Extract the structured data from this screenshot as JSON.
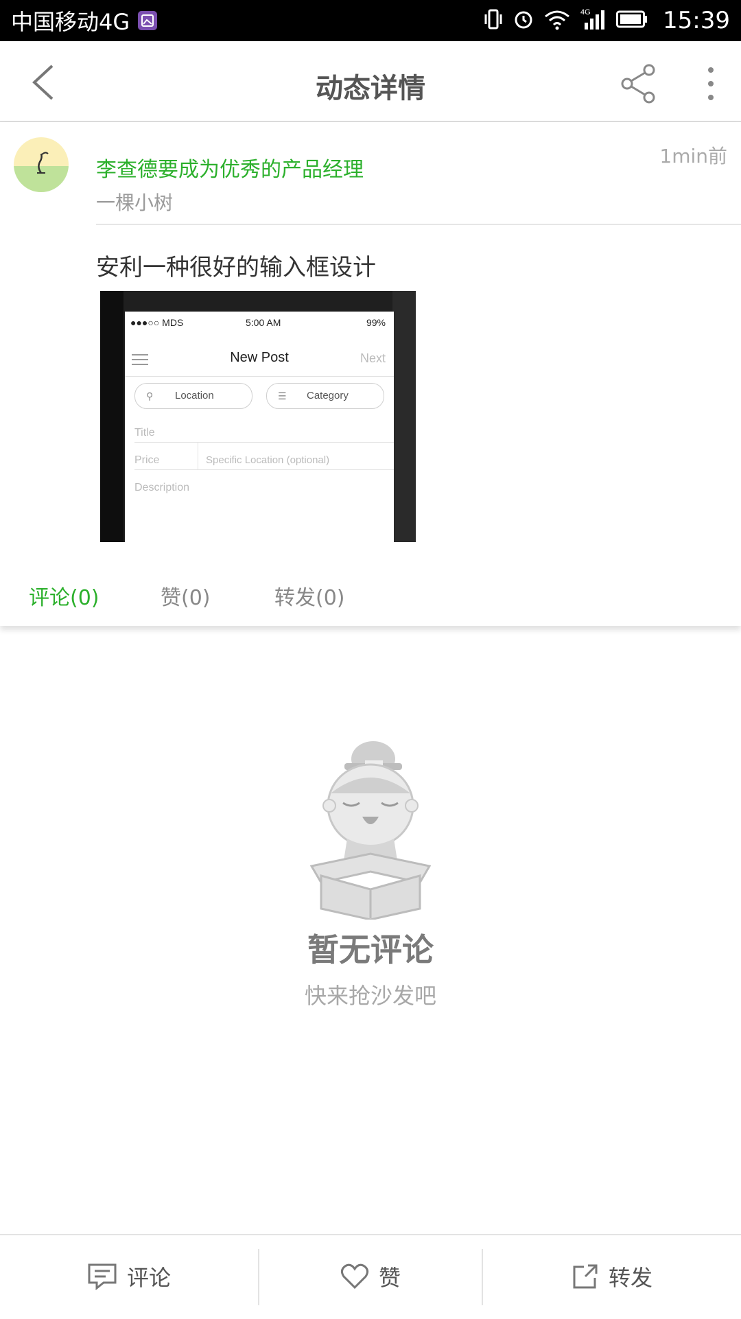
{
  "status_bar": {
    "carrier": "中国移动4G",
    "network": "4G",
    "time": "15:39"
  },
  "header": {
    "title": "动态详情",
    "icons": [
      "back-arrow-icon",
      "share-icon",
      "more-vert-icon"
    ]
  },
  "post": {
    "author_name": "李查德要成为优秀的产品经理",
    "author_sub": "一棵小树",
    "time": "1min前",
    "text": "安利一种很好的输入框设计",
    "image": {
      "status_left": "●●●○○ MDS",
      "status_time": "5:00 AM",
      "status_battery": "99%",
      "title": "New Post",
      "next": "Next",
      "chip_location": "Location",
      "chip_category": "Category",
      "field_title": "Title",
      "field_price": "Price",
      "field_specific": "Specific Location (optional)",
      "field_description": "Description"
    }
  },
  "tabs": [
    {
      "label": "评论(0)",
      "active": true
    },
    {
      "label": "赞(0)",
      "active": false
    },
    {
      "label": "转发(0)",
      "active": false
    }
  ],
  "empty_state": {
    "title": "暂无评论",
    "subtitle": "快来抢沙发吧"
  },
  "bottom_bar": [
    {
      "label": "评论",
      "icon": "comment-icon"
    },
    {
      "label": "赞",
      "icon": "heart-icon"
    },
    {
      "label": "转发",
      "icon": "forward-icon"
    }
  ],
  "colors": {
    "accent_green": "#2cb02c",
    "status_bar": "#000000",
    "badge_purple": "#7b4fb0"
  }
}
